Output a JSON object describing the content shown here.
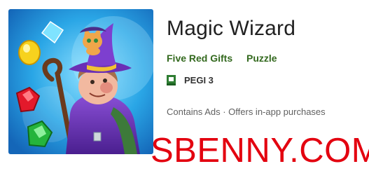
{
  "app": {
    "title": "Magic Wizard",
    "developer": "Five Red Gifts",
    "category": "Puzzle",
    "rating_icon": "pegi-rating-icon",
    "rating": "PEGI 3",
    "ads_notice": "Contains Ads · Offers in-app purchases"
  },
  "watermark": {
    "text": "SBENNY.COM",
    "color": "#e3000f"
  },
  "colors": {
    "link_green": "#33691e",
    "art_sky": "#2aa6e6"
  }
}
